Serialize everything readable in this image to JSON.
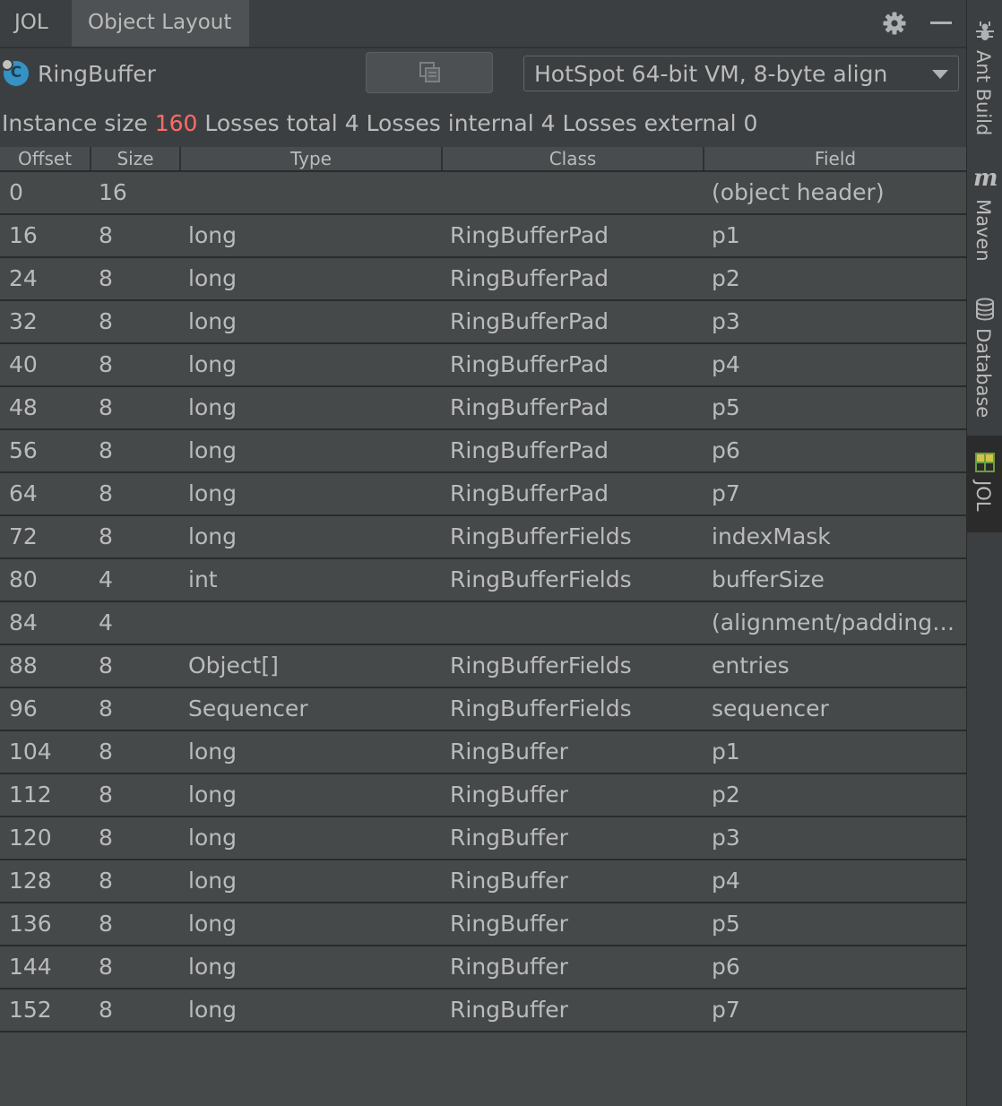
{
  "tool_window": {
    "name": "JOL",
    "tab": "Object Layout"
  },
  "icons": {
    "settings": "gear-icon",
    "minimize": "minimize-icon",
    "class": "class-icon",
    "copy": "copy-icon",
    "ant": "ant-icon",
    "maven": "maven-icon",
    "database": "database-icon",
    "jol": "jol-icon"
  },
  "toolbar": {
    "class_icon_letter": "C",
    "class_name": "RingBuffer",
    "vm_mode": "HotSpot 64-bit VM, 8-byte align"
  },
  "summary": {
    "instance_size_label": "Instance size",
    "instance_size": "160",
    "losses_total_label": "Losses total",
    "losses_total": "4",
    "losses_internal_label": "Losses internal",
    "losses_internal": "4",
    "losses_external_label": "Losses external",
    "losses_external": "0"
  },
  "table": {
    "columns": [
      "Offset",
      "Size",
      "Type",
      "Class",
      "Field"
    ],
    "rows": [
      [
        "0",
        "16",
        "",
        "",
        "(object header)"
      ],
      [
        "16",
        "8",
        "long",
        "RingBufferPad",
        "p1"
      ],
      [
        "24",
        "8",
        "long",
        "RingBufferPad",
        "p2"
      ],
      [
        "32",
        "8",
        "long",
        "RingBufferPad",
        "p3"
      ],
      [
        "40",
        "8",
        "long",
        "RingBufferPad",
        "p4"
      ],
      [
        "48",
        "8",
        "long",
        "RingBufferPad",
        "p5"
      ],
      [
        "56",
        "8",
        "long",
        "RingBufferPad",
        "p6"
      ],
      [
        "64",
        "8",
        "long",
        "RingBufferPad",
        "p7"
      ],
      [
        "72",
        "8",
        "long",
        "RingBufferFields",
        "indexMask"
      ],
      [
        "80",
        "4",
        "int",
        "RingBufferFields",
        "bufferSize"
      ],
      [
        "84",
        "4",
        "",
        "",
        "(alignment/padding ..."
      ],
      [
        "88",
        "8",
        "Object[]",
        "RingBufferFields",
        "entries"
      ],
      [
        "96",
        "8",
        "Sequencer",
        "RingBufferFields",
        "sequencer"
      ],
      [
        "104",
        "8",
        "long",
        "RingBuffer",
        "p1"
      ],
      [
        "112",
        "8",
        "long",
        "RingBuffer",
        "p2"
      ],
      [
        "120",
        "8",
        "long",
        "RingBuffer",
        "p3"
      ],
      [
        "128",
        "8",
        "long",
        "RingBuffer",
        "p4"
      ],
      [
        "136",
        "8",
        "long",
        "RingBuffer",
        "p5"
      ],
      [
        "144",
        "8",
        "long",
        "RingBuffer",
        "p6"
      ],
      [
        "152",
        "8",
        "long",
        "RingBuffer",
        "p7"
      ]
    ]
  },
  "right_stripe": {
    "items": [
      "Ant Build",
      "Maven",
      "Database",
      "JOL"
    ],
    "active": "JOL"
  },
  "colors": {
    "background": "#3c3f41",
    "table_row": "#45494a",
    "accent_red": "#ff6b68",
    "class_icon": "#3592c4"
  }
}
